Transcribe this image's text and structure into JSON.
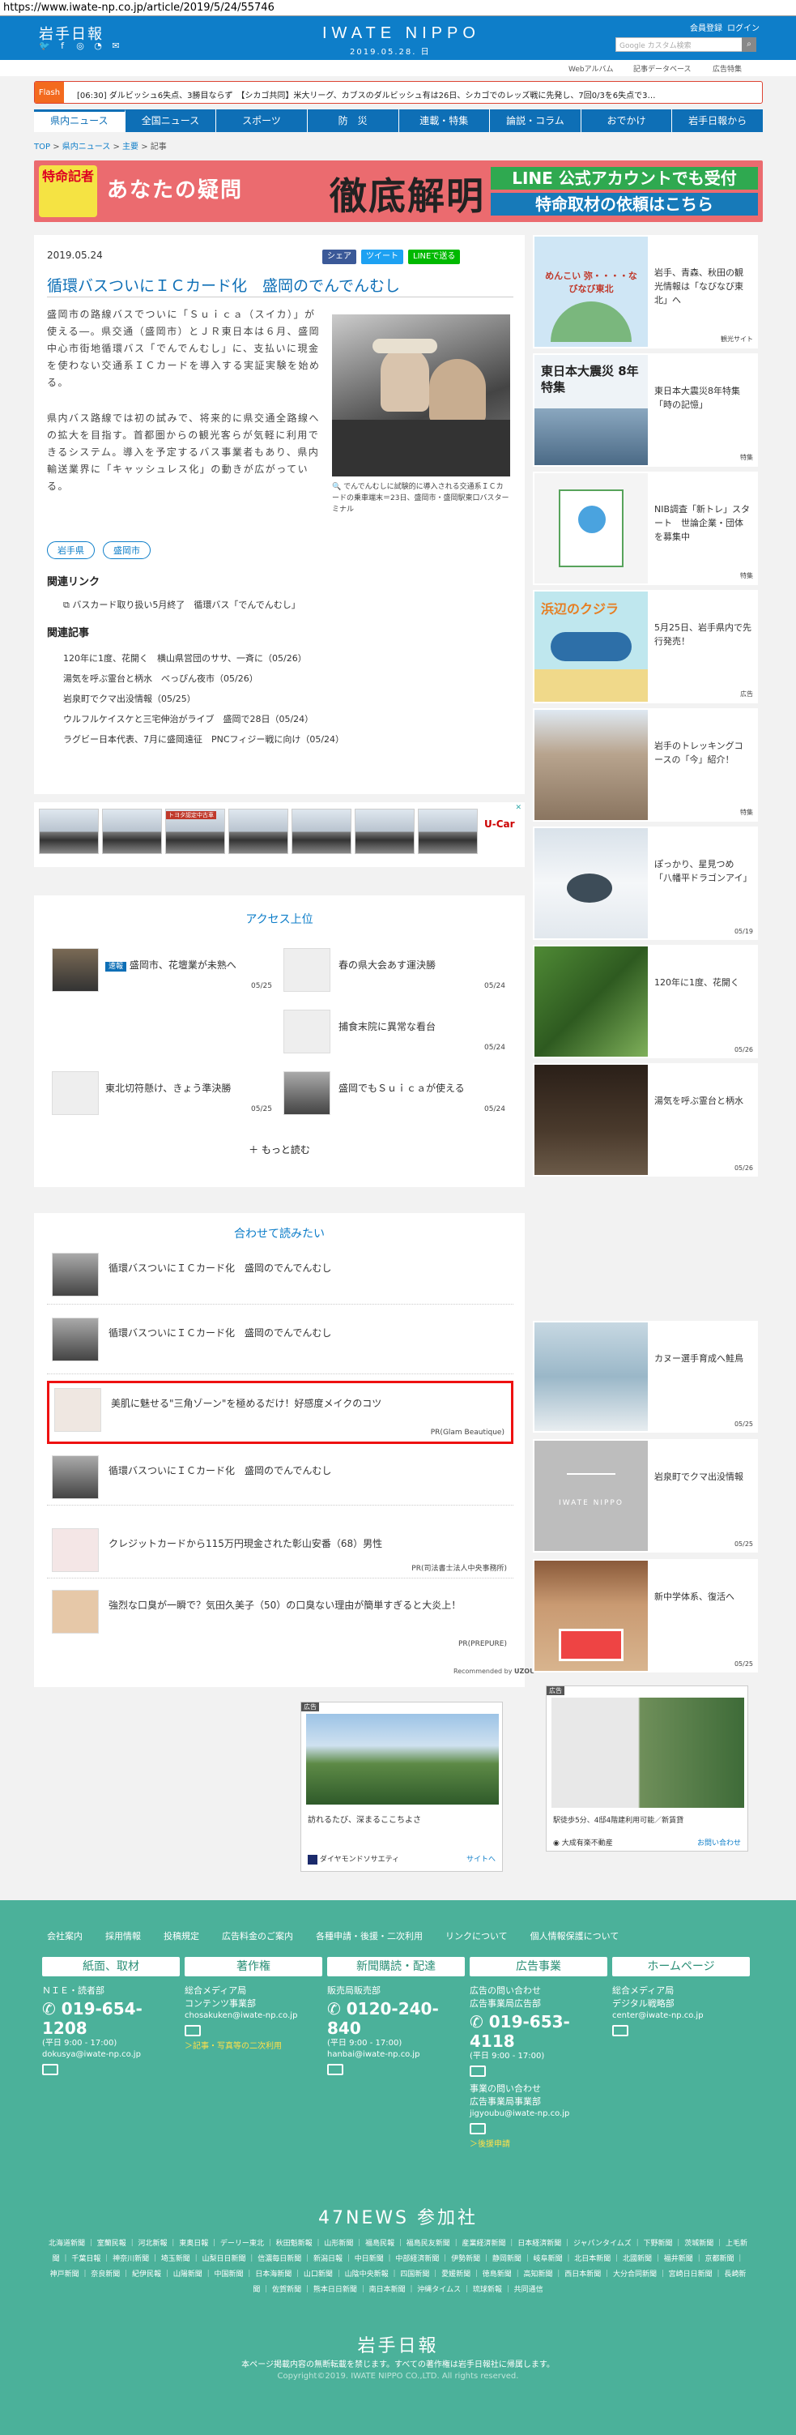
{
  "url": "https://www.iwate-np.co.jp/article/2019/5/24/55746",
  "header": {
    "logo": "岩手日報",
    "site_name": "IWATE NIPPO",
    "date": "2019.05.28. 日",
    "links": [
      "会員登録",
      "ログイン"
    ],
    "search_placeholder": "Google カスタム検索",
    "subnav": [
      "Webアルバム",
      "記事データベース",
      "広告特集"
    ]
  },
  "flash": {
    "label": "Flash",
    "text": "[06:30] ダルビッシュ6失点、3勝目ならず　【シカゴ共同】米大リーグ、カブスのダルビッシュ有は26日、シカゴでのレッズ戦に先発し、7回0/3を6失点で3…"
  },
  "gnav": [
    "県内ニュース",
    "全国ニュース",
    "スポーツ",
    "防　災",
    "連載・特集",
    "論説・コラム",
    "おでかけ",
    "岩手日報から"
  ],
  "breadcrumb": [
    "TOP",
    "県内ニュース",
    "主要",
    "記事"
  ],
  "banner": {
    "left": "特命記者",
    "mid": "あなたの疑問",
    "big": "徹底解明",
    "right1": "LINE 公式アカウントでも受付",
    "right2": "特命取材の依頼はこちら"
  },
  "article": {
    "date": "2019.05.24",
    "share": [
      "シェア",
      "ツイート",
      "LINEで送る"
    ],
    "title": "循環バスついにＩＣカード化　盛岡のでんでんむし",
    "body1": "盛岡市の路線バスでついに「Ｓｕｉｃａ（スイカ）」が使える―。県交通（盛岡市）とＪＲ東日本は６月、盛岡中心市街地循環バス「でんでんむし」に、支払いに現金を使わない交通系ＩＣカードを導入する実証実験を始める。",
    "body2": "県内バス路線では初の試みで、将来的に県交通全路線への拡大を目指す。首都圏からの観光客らが気軽に利用できるシステム。導入を予定するバス事業者もあり、県内輸送業界に「キャッシュレス化」の動きが広がっている。",
    "caption": "でんでんむしに試験的に導入される交通系ＩＣカードの乗車端末＝23日、盛岡市・盛岡駅東口バスターミナル",
    "tags": [
      "岩手県",
      "盛岡市"
    ],
    "related_links_title": "関連リンク",
    "related_link": "バスカード取り扱い5月終了　循環バス「でんでんむし」",
    "related_articles_title": "関連記事",
    "related_articles": [
      "120年に1度、花開く　横山県営団のササ、一斉に（05/26）",
      "湯気を呼ぶ霊台と柄水　べっぴん夜市（05/26）",
      "岩泉町でクマ出没情報（05/25）",
      "ウルフルケイスケと三宅伸治がライブ　盛岡で28日（05/24）",
      "ラグビー日本代表、7月に盛岡遠征　PNCフィジー戦に向け（05/24）"
    ]
  },
  "ad_strip": {
    "labels": [
      "トヨタ認定中古車",
      "U-Car T-Value"
    ],
    "brand": "U-Car"
  },
  "access": {
    "title": "アクセス上位",
    "items": [
      {
        "badge": "速報",
        "text": "盛岡市、花壇業が未熟へ",
        "date": "05/25"
      },
      {
        "badge": "",
        "text": "春の県大会あす運決勝",
        "date": "05/24"
      },
      {
        "badge": "",
        "text": "捕食末院に異常な看台",
        "date": "05/24"
      },
      {
        "badge": "",
        "text": "東北切符懸け、きょう準決勝",
        "date": "05/25"
      },
      {
        "badge": "",
        "text": "盛岡でもＳｕｉｃａが使える",
        "date": "05/24"
      }
    ],
    "more": "もっと読む"
  },
  "read_more": {
    "title": "合わせて読みたい",
    "items": [
      {
        "text": "循環バスついにＩＣカード化　盛岡のでんでんむし",
        "pr": ""
      },
      {
        "text": "循環バスついにＩＣカード化　盛岡のでんでんむし",
        "pr": ""
      },
      {
        "text": "美肌に魅せる\"三角ゾーン\"を極めるだけ！好感度メイクのコツ",
        "pr": "PR(Glam Beautique)"
      },
      {
        "text": "循環バスついにＩＣカード化　盛岡のでんでんむし",
        "pr": ""
      },
      {
        "text": "クレジットカードから115万円現金された彰山安番（68）男性",
        "pr": "PR(司法書士法人中央事務所)"
      },
      {
        "text": "強烈な口臭が一瞬で？気田久美子（50）の口臭ない理由が簡単すぎると大炎上！",
        "pr": "PR(PREPURE)"
      }
    ],
    "recommended": "Recommended by",
    "recommended_brand": "UZOU"
  },
  "ad_bottom1": {
    "label": "広告",
    "text": "訪れるたび、深まるここちよさ",
    "brand": "ダイヤモンドソサエティ",
    "link": "サイトへ"
  },
  "ad_bottom2": {
    "label": "広告",
    "text": "駅徒歩5分、4邸4階建利用可能／新賃貸",
    "brand": "大成有楽不動産",
    "link": "お問い合わせ"
  },
  "sidebar": [
    {
      "text": "岩手、青森、秋田の観光情報は「なびなび東北」へ",
      "date": "観光サイト",
      "color": "#cfe6f5"
    },
    {
      "text": "東日本大震災8年特集「時の記憶」",
      "date": "特集",
      "color": "#eef3f7"
    },
    {
      "text": "NIB調査「新トレ」スタート　世論企業・団体を募集中",
      "date": "特集",
      "color": "#f2f2f2"
    },
    {
      "text": "5月25日、岩手県内で先行発売！",
      "date": "広告",
      "color": "#bfe7ee"
    },
    {
      "text": "岩手のトレッキングコースの「今」紹介！",
      "date": "特集",
      "color": "#c9b7a3"
    },
    {
      "text": "ぽっかり、星見つめ「八幡平ドラゴンアイ」",
      "date": "05/19",
      "color": "#dde6ee"
    },
    {
      "text": "120年に1度、花開く",
      "date": "05/26",
      "color": "#5f8f3e"
    },
    {
      "text": "湯気を呼ぶ霊台と柄水",
      "date": "05/26",
      "color": "#3a2b20"
    },
    {
      "text": "カヌー選手育成へ鮭鳥",
      "date": "05/25",
      "color": "#c7d8e2"
    },
    {
      "text": "岩泉町でクマ出没情報",
      "date": "05/25",
      "color": "#bdbdbd"
    },
    {
      "text": "新中学体系、復活へ",
      "date": "05/25",
      "color": "#8a5a3a"
    }
  ],
  "sidebar_placeholder": {
    "name": "IWATE NIPPO"
  },
  "sidebar_images": {
    "navinavi": "めんこい 弥・・・・なびなび東北",
    "shinsai": "東日本大震災 8年特集",
    "kujira": "浜辺のクジラ"
  },
  "footer": {
    "links": [
      "会社案内",
      "採用情報",
      "投稿規定",
      "広告料金のご案内",
      "各種申請・後援・二次利用",
      "リンクについて",
      "個人情報保護について"
    ],
    "cols": [
      {
        "head": "紙面、取材",
        "sub": "ＮＩＥ・読者部",
        "phone": "019-654-1208",
        "hours": "(平日 9:00 - 17:00)",
        "email": "dokusya@iwate-np.co.jp",
        "extra": ""
      },
      {
        "head": "著作権",
        "sub": "総合メディア局\nコンテンツ事業部",
        "phone": "",
        "hours": "",
        "email": "chosakuken@iwate-np.co.jp",
        "extra": "＞記事・写真等の二次利用"
      },
      {
        "head": "新聞購読・配達",
        "sub": "販売局販売部",
        "phone": "0120-240-840",
        "hours": "(平日 9:00 - 17:00)",
        "email": "hanbai@iwate-np.co.jp",
        "extra": ""
      },
      {
        "head": "広告事業",
        "sub": "広告の問い合わせ\n広告事業局広告部",
        "phone": "019-653-4118",
        "hours": "(平日 9:00 - 17:00)",
        "email": "jigyoubu@iwate-np.co.jp",
        "extra": "＞後援申請",
        "sub2": "事業の問い合わせ\n広告事業局事業部"
      },
      {
        "head": "ホームページ",
        "sub": "総合メディア局\nデジタル戦略部",
        "phone": "",
        "hours": "",
        "email": "center@iwate-np.co.jp",
        "extra": ""
      }
    ],
    "news47": "47NEWS 参加社",
    "papers": "北海道新聞 ｜ 室蘭民報 ｜ 河北新報 ｜ 東奥日報 ｜ デーリー東北 ｜ 秋田魁新報 ｜ 山形新聞 ｜ 福島民報 ｜ 福島民友新聞 ｜ 産業経済新聞 ｜ 日本経済新聞 ｜ ジャパンタイムズ ｜ 下野新聞 ｜ 茨城新聞 ｜ 上毛新聞 ｜ 千葉日報 ｜ 神奈川新聞 ｜ 埼玉新聞 ｜ 山梨日日新聞 ｜ 信濃毎日新聞 ｜ 新潟日報 ｜ 中日新聞 ｜ 中部経済新聞 ｜ 伊勢新聞 ｜ 静岡新聞 ｜ 岐阜新聞 ｜ 北日本新聞 ｜ 北國新聞 ｜ 福井新聞 ｜ 京都新聞 ｜ 神戸新聞 ｜ 奈良新聞 ｜ 紀伊民報 ｜ 山陽新聞 ｜ 中国新聞 ｜ 日本海新聞 ｜ 山口新聞 ｜ 山陰中央新報 ｜ 四国新聞 ｜ 愛媛新聞 ｜ 徳島新聞 ｜ 高知新聞 ｜ 西日本新聞 ｜ 大分合同新聞 ｜ 宮崎日日新聞 ｜ 長崎新聞 ｜ 佐賀新聞 ｜ 熊本日日新聞 ｜ 南日本新聞 ｜ 沖縄タイムス ｜ 琉球新報 ｜ 共同通信",
    "logo": "岩手日報",
    "copy1": "本ページ掲載内容の無断転載を禁じます。すべての著作権は岩手日報社に帰属します。",
    "copy2": "Copyright©2019. IWATE NIPPO CO.,LTD. All rights reserved."
  }
}
